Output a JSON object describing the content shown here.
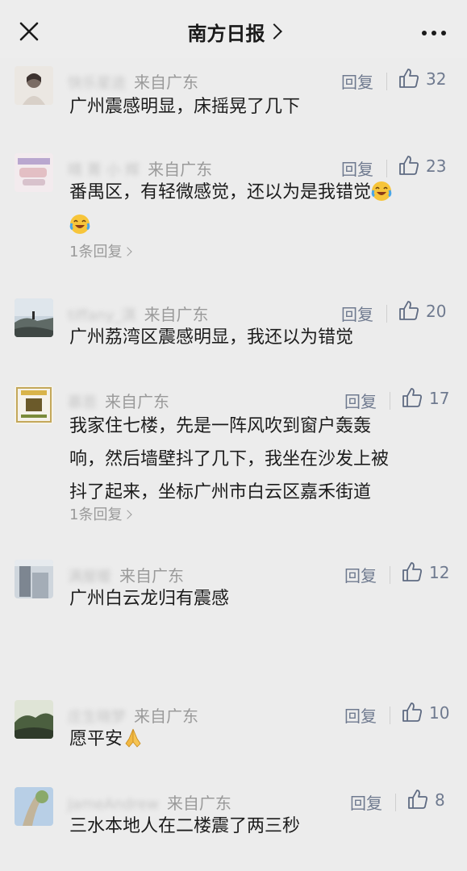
{
  "header": {
    "title": "南方日报",
    "close_icon": "close-icon",
    "more_icon": "more-icon"
  },
  "ui": {
    "reply_label": "回复",
    "region_label": "来自广东",
    "like_icon": "thumbs-up-icon"
  },
  "comments": [
    {
      "nickname": "快乐星途",
      "region": "来自广东",
      "likes": "32",
      "text": "广州震感明显，床摇晃了几下",
      "sub_replies": ""
    },
    {
      "nickname": "晴 菁 小 辉",
      "region": "来自广东",
      "likes": "23",
      "text": "番禺区，有轻微感觉，还以为是我错觉",
      "emoji": "laughing-crying-emoji",
      "sub_replies": "1条回复"
    },
    {
      "nickname": "tiffany_淇",
      "region": "来自广东",
      "likes": "20",
      "text": "广州荔湾区震感明显，我还以为错觉",
      "sub_replies": ""
    },
    {
      "nickname": "慕恩",
      "region": "来自广东",
      "likes": "17",
      "text_lines": [
        "我家住七楼，先是一阵风吹到窗户轰轰",
        "响，然后墙壁抖了几下，我坐在沙发上被",
        "抖了起来，坐标广州市白云区嘉禾街道"
      ],
      "sub_replies": "1条回复"
    },
    {
      "nickname": "满屋暖",
      "region": "来自广东",
      "likes": "12",
      "text": "广州白云龙归有震感",
      "sub_replies": ""
    },
    {
      "nickname": "庄生晓梦",
      "region": "来自广东",
      "likes": "10",
      "text": "愿平安",
      "emoji": "folded-hands-emoji",
      "sub_replies": ""
    },
    {
      "nickname": "JameAndrew",
      "region": "来自广东",
      "likes": "8",
      "text": "三水本地人在二楼震了两三秒",
      "sub_replies": ""
    }
  ]
}
